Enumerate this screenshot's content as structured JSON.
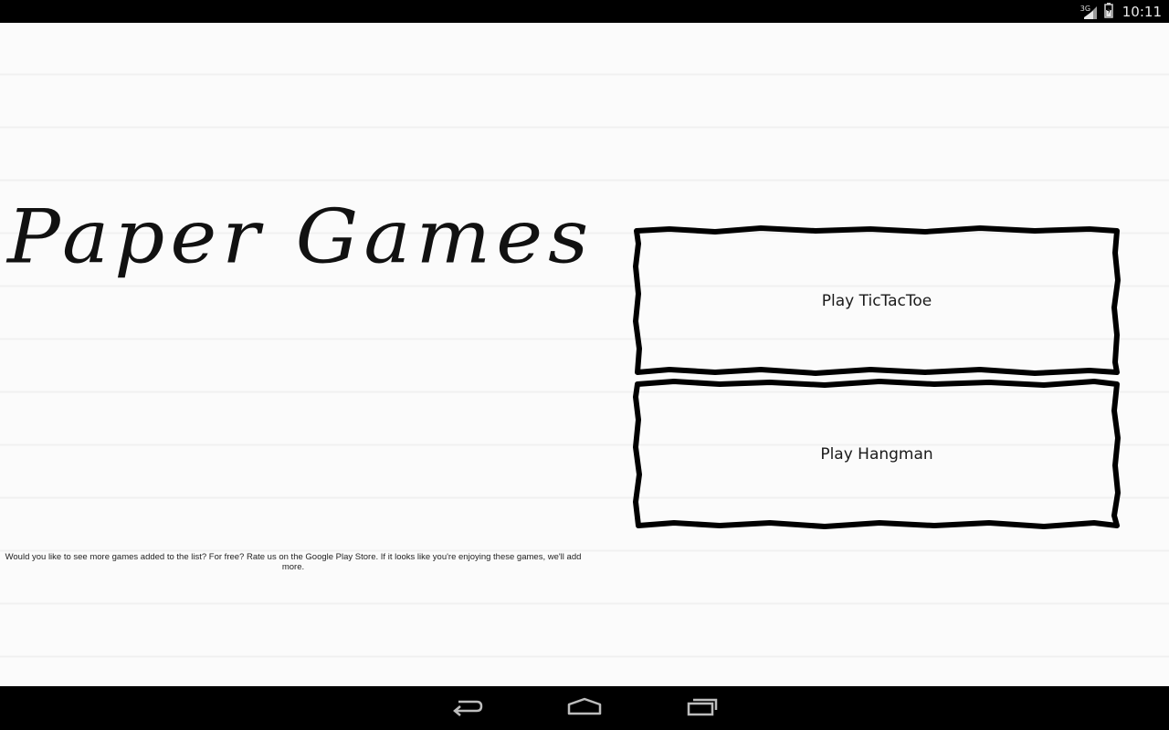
{
  "status_bar": {
    "network": "3G",
    "time": "10:11"
  },
  "main": {
    "title": "Paper Games",
    "note": "Would you like to see more games added to the list? For free? Rate us on the Google Play Store. If it looks like you're enjoying these games, we'll add more."
  },
  "buttons": {
    "tictactoe": "Play TicTacToe",
    "hangman": "Play Hangman"
  },
  "colors": {
    "paper": "#fbfbfb",
    "ink": "#111111",
    "system_bar": "#000000"
  },
  "icons": {
    "signal": "signal-icon",
    "battery": "battery-icon",
    "back": "back-icon",
    "home": "home-icon",
    "recents": "recents-icon"
  }
}
